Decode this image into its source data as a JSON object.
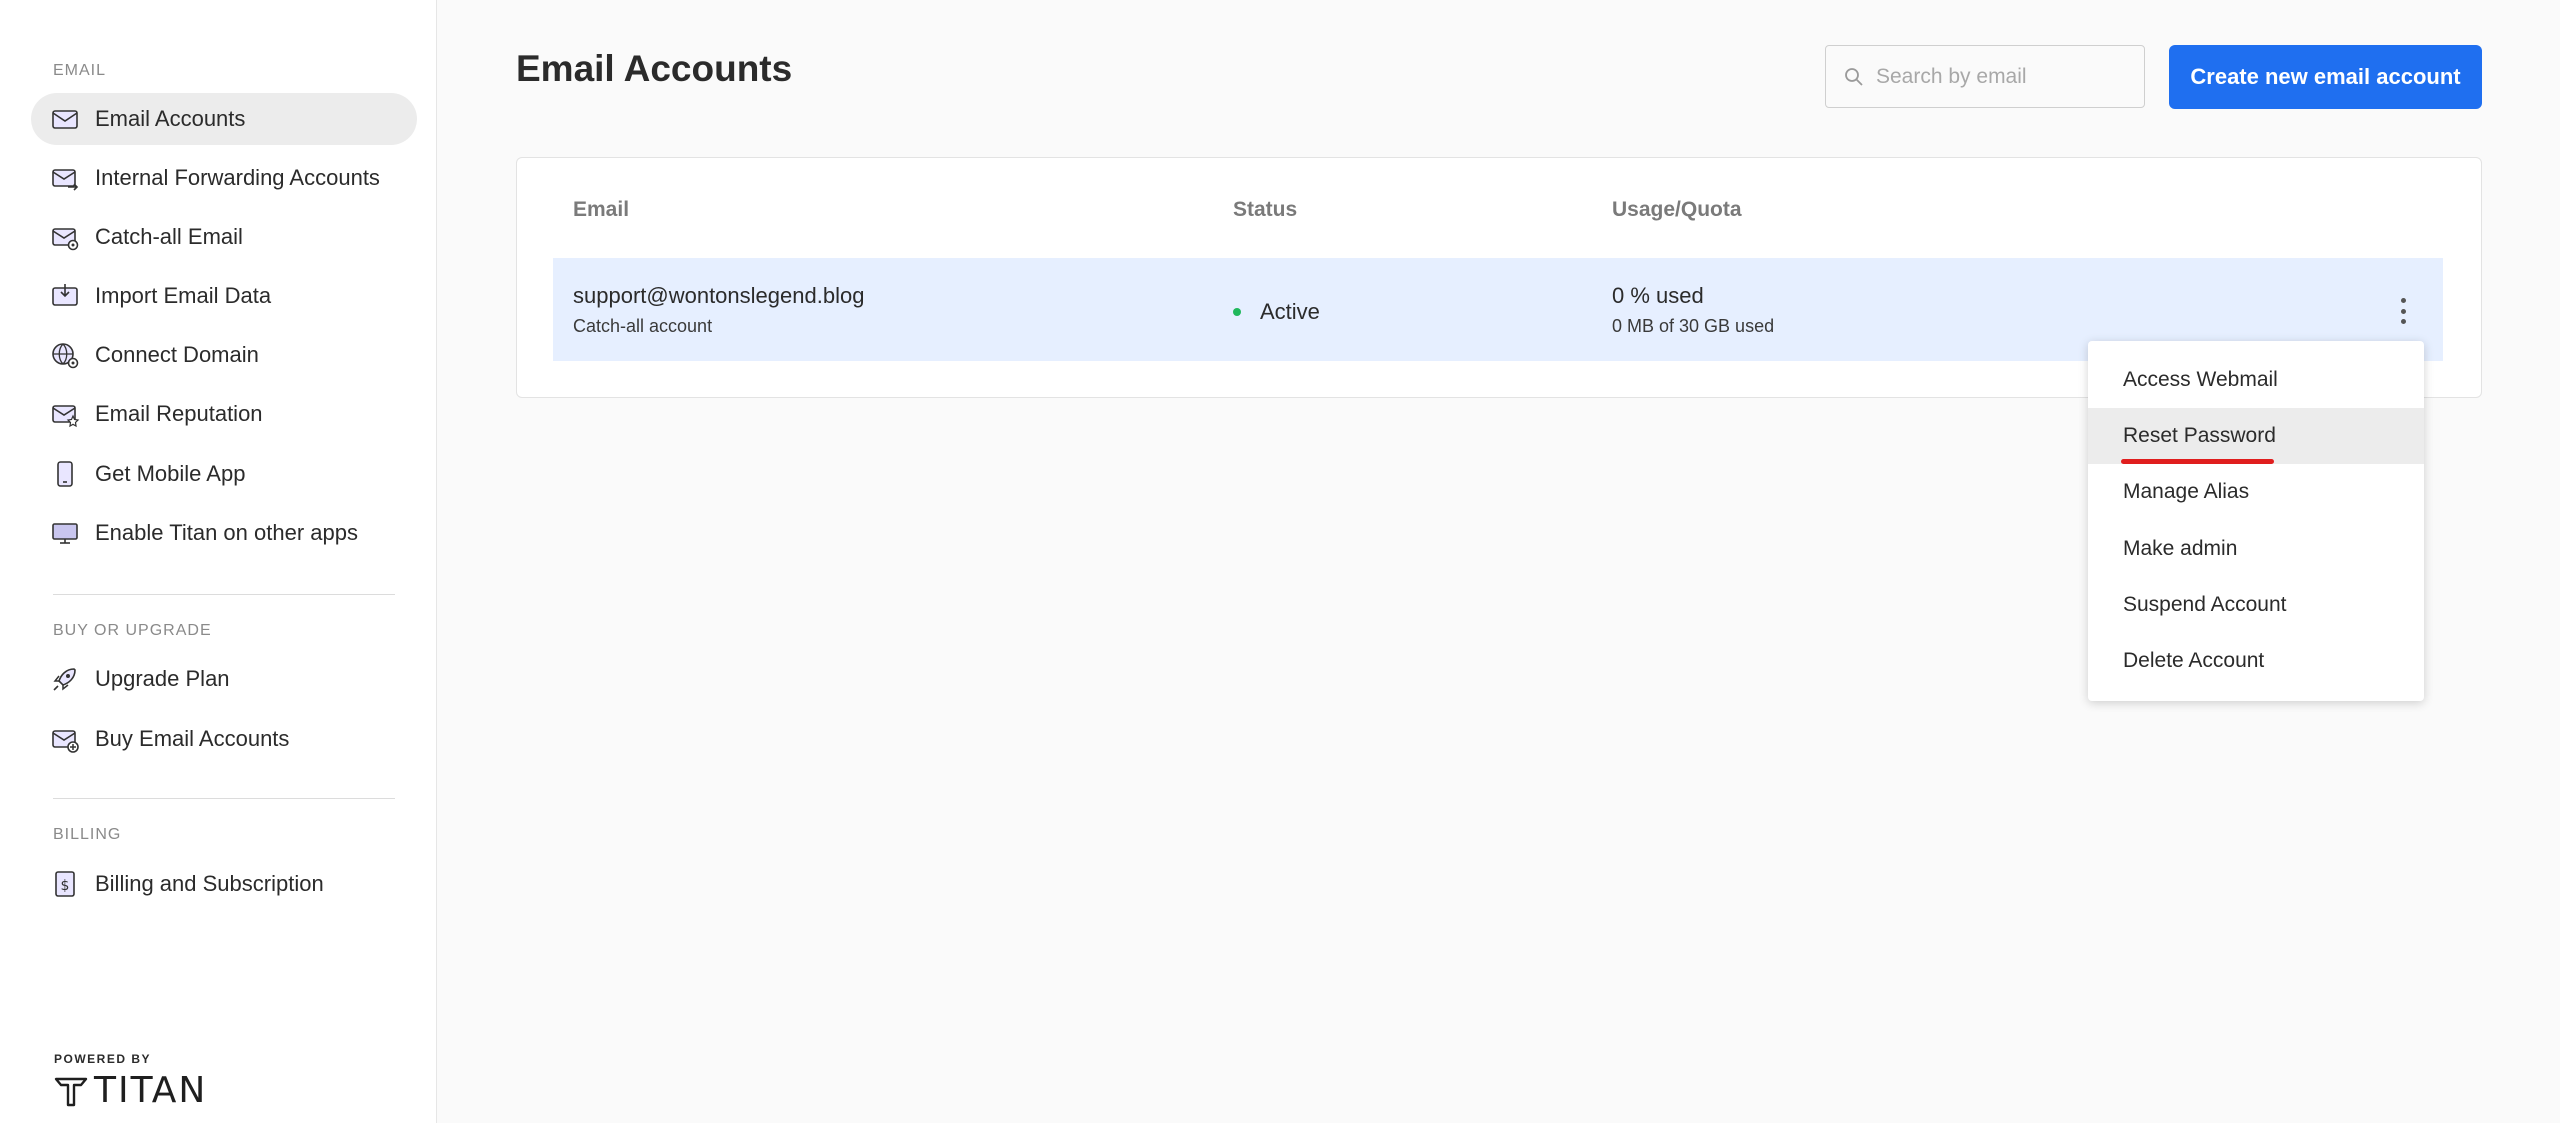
{
  "sidebar": {
    "sections": [
      {
        "title": "EMAIL"
      },
      {
        "title": "BUY OR UPGRADE"
      },
      {
        "title": "BILLING"
      }
    ],
    "email_items": [
      {
        "label": "Email Accounts",
        "icon": "mail-icon",
        "active": true
      },
      {
        "label": "Internal Forwarding Accounts",
        "icon": "mail-forward-icon"
      },
      {
        "label": "Catch-all Email",
        "icon": "mail-gear-icon"
      },
      {
        "label": "Import Email Data",
        "icon": "mail-import-icon"
      },
      {
        "label": "Connect Domain",
        "icon": "globe-gear-icon"
      },
      {
        "label": "Email Reputation",
        "icon": "mail-star-icon"
      },
      {
        "label": "Get Mobile App",
        "icon": "phone-icon"
      },
      {
        "label": "Enable Titan on other apps",
        "icon": "monitor-icon"
      }
    ],
    "upgrade_items": [
      {
        "label": "Upgrade Plan",
        "icon": "rocket-icon"
      },
      {
        "label": "Buy Email Accounts",
        "icon": "mail-plus-icon"
      }
    ],
    "billing_items": [
      {
        "label": "Billing and Subscription",
        "icon": "dollar-document-icon"
      }
    ],
    "powered_by": "POWERED BY",
    "brand": "TITAN"
  },
  "header": {
    "title": "Email Accounts",
    "search_placeholder": "Search by email",
    "create_button": "Create new email account"
  },
  "table": {
    "columns": [
      "Email",
      "Status",
      "Usage/Quota"
    ],
    "rows": [
      {
        "email": "support@wontonslegend.blog",
        "subtitle": "Catch-all account",
        "status": "Active",
        "usage": "0 % used",
        "quota": "0 MB of 30 GB used"
      }
    ]
  },
  "row_menu": {
    "items": [
      "Access Webmail",
      "Reset Password",
      "Manage Alias",
      "Make admin",
      "Suspend Account",
      "Delete Account"
    ],
    "hovered": "Reset Password"
  },
  "colors": {
    "accent": "#1f6ff0",
    "row_highlight": "#e6efff",
    "status_active": "#20b85c",
    "annotation": "#e01e1e"
  }
}
